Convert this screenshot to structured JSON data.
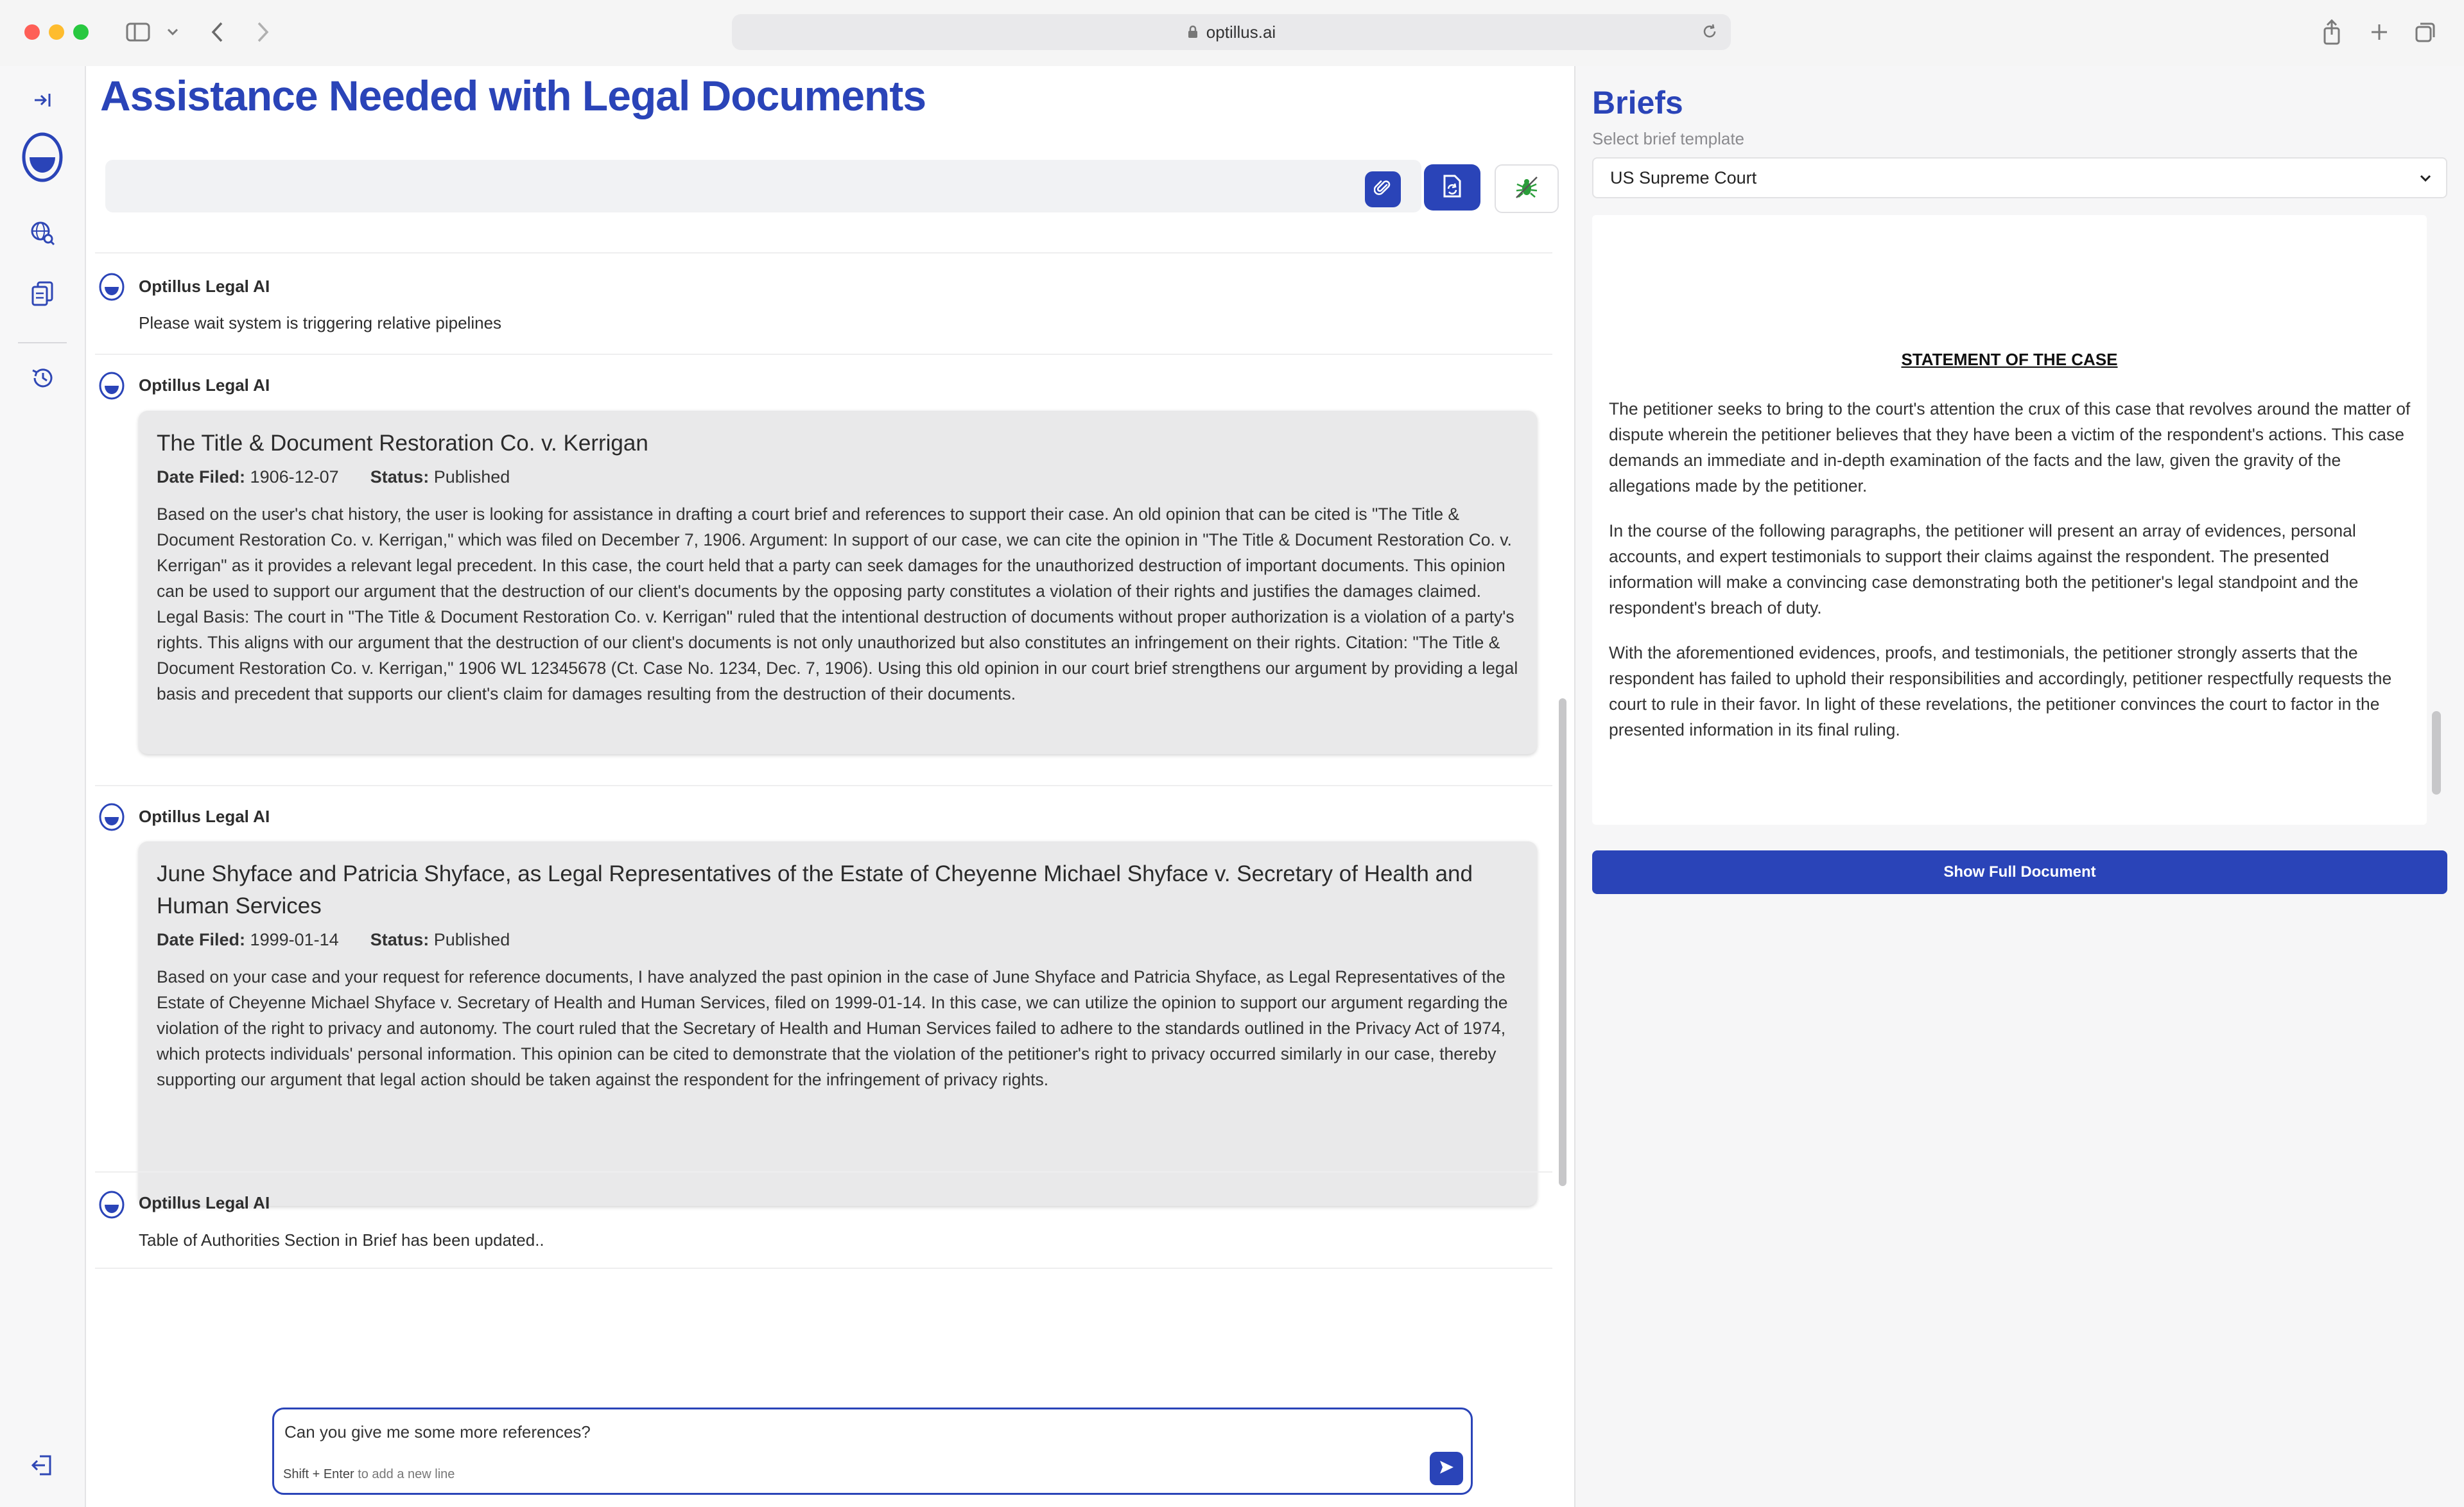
{
  "browser": {
    "url": "optillus.ai"
  },
  "page": {
    "title": "Assistance Needed with Legal Documents"
  },
  "messages": [
    {
      "sender": "Optillus Legal AI",
      "text": "Please wait system is triggering relative pipelines"
    },
    {
      "sender": "Optillus Legal AI",
      "card": {
        "title": "The Title & Document Restoration Co. v. Kerrigan",
        "date_label": "Date Filed:",
        "date": "1906-12-07",
        "status_label": "Status:",
        "status": "Published",
        "body": "Based on the user's chat history, the user is looking for assistance in drafting a court brief and references to support their case. An old opinion that can be cited is \"The Title & Document Restoration Co. v. Kerrigan,\" which was filed on December 7, 1906. Argument: In support of our case, we can cite the opinion in \"The Title & Document Restoration Co. v. Kerrigan\" as it provides a relevant legal precedent. In this case, the court held that a party can seek damages for the unauthorized destruction of important documents. This opinion can be used to support our argument that the destruction of our client's documents by the opposing party constitutes a violation of their rights and justifies the damages claimed. Legal Basis: The court in \"The Title & Document Restoration Co. v. Kerrigan\" ruled that the intentional destruction of documents without proper authorization is a violation of a party's rights. This aligns with our argument that the destruction of our client's documents is not only unauthorized but also constitutes an infringement on their rights. Citation: \"The Title & Document Restoration Co. v. Kerrigan,\" 1906 WL 12345678 (Ct. Case No. 1234, Dec. 7, 1906). Using this old opinion in our court brief strengthens our argument by providing a legal basis and precedent that supports our client's claim for damages resulting from the destruction of their documents."
      }
    },
    {
      "sender": "Optillus Legal AI",
      "card": {
        "title": "June Shyface and Patricia Shyface, as Legal Representatives of the Estate of Cheyenne Michael Shyface v. Secretary of Health and Human Services",
        "date_label": "Date Filed:",
        "date": "1999-01-14",
        "status_label": "Status:",
        "status": "Published",
        "body": "Based on your case and your request for reference documents, I have analyzed the past opinion in the case of June Shyface and Patricia Shyface, as Legal Representatives of the Estate of Cheyenne Michael Shyface v. Secretary of Health and Human Services, filed on 1999-01-14. In this case, we can utilize the opinion to support our argument regarding the violation of the right to privacy and autonomy. The court ruled that the Secretary of Health and Human Services failed to adhere to the standards outlined in the Privacy Act of 1974, which protects individuals' personal information. This opinion can be cited to demonstrate that the violation of the petitioner's right to privacy occurred similarly in our case, thereby supporting our argument that legal action should be taken against the respondent for the infringement of privacy rights."
      }
    },
    {
      "sender": "Optillus Legal AI",
      "text": "Table of Authorities Section in Brief has been updated.."
    }
  ],
  "composer": {
    "value": "Can you give me some more references?",
    "hint_keys": "Shift + Enter",
    "hint_text": "to add a new line"
  },
  "briefs": {
    "title": "Briefs",
    "select_label": "Select brief template",
    "selected_template": "US Supreme Court",
    "document": {
      "heading": "STATEMENT OF THE CASE",
      "paragraphs": [
        "The petitioner seeks to bring to the court's attention the crux of this case that revolves around the matter of dispute wherein the petitioner believes that they have been a victim of the respondent's actions. This case demands an immediate and in-depth examination of the facts and the law, given the gravity of the allegations made by the petitioner.",
        "In the course of the following paragraphs, the petitioner will present an array of evidences, personal accounts, and expert testimonials to support their claims against the respondent. The presented information will make a convincing case demonstrating both the petitioner's legal standpoint and the respondent's breach of duty.",
        "With the aforementioned evidences, proofs, and testimonials, the petitioner strongly asserts that the respondent has failed to uphold their responsibilities and accordingly, petitioner respectfully requests the court to rule in their favor. In light of these revelations, the petitioner convinces the court to factor in the presented information in its final ruling."
      ]
    },
    "show_full_label": "Show Full Document"
  },
  "icons": {
    "rail": [
      "expand-sidebar-icon",
      "optillus-logo-icon",
      "web-search-icon",
      "documents-icon",
      "history-icon",
      "logout-icon"
    ],
    "toolbar": [
      "paperclip-icon",
      "document-refresh-icon",
      "bug-icon"
    ],
    "chrome": [
      "sidebar-toggle-icon",
      "chevron-down-icon",
      "back-icon",
      "forward-icon",
      "share-icon",
      "new-tab-icon",
      "tab-overview-icon"
    ]
  },
  "colors": {
    "accent": "#2a44b8",
    "card_bg": "#e9e9ea",
    "bug_green": "#2a9d3a"
  }
}
